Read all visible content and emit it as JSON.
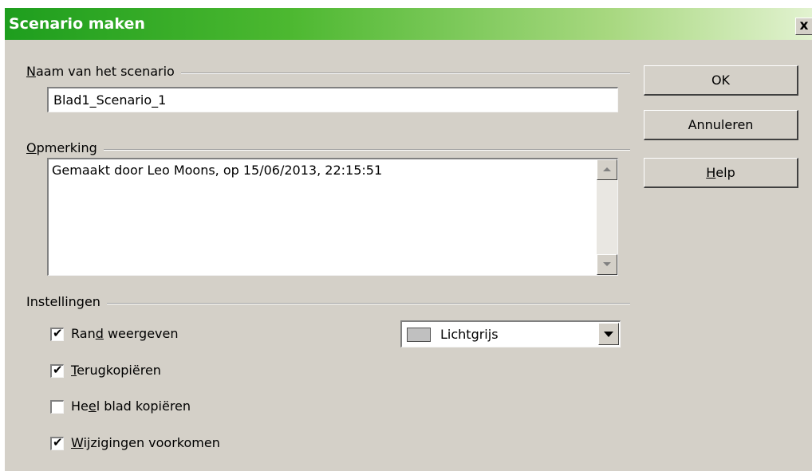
{
  "dialog": {
    "title": "Scenario maken",
    "close_label": "x"
  },
  "name_group": {
    "label_u": "N",
    "label_rest": "aam van het scenario",
    "value": "Blad1_Scenario_1"
  },
  "comment_group": {
    "label_u": "O",
    "label_rest": "pmerking",
    "value": "Gemaakt door Leo Moons, op 15/06/2013, 22:15:51"
  },
  "settings_group": {
    "label": "Instellingen",
    "checkboxes": [
      {
        "pre": "Ran",
        "u": "d",
        "post": " weergeven",
        "checked": true,
        "check_glyph": "✔"
      },
      {
        "pre": "",
        "u": "T",
        "post": "erugkopiëren",
        "checked": true,
        "check_glyph": "✔"
      },
      {
        "pre": "He",
        "u": "e",
        "post": "l blad kopiëren",
        "checked": false,
        "check_glyph": ""
      },
      {
        "pre": "",
        "u": "W",
        "post": "ijzigingen voorkomen",
        "checked": true,
        "check_glyph": "✔"
      }
    ],
    "color_select": {
      "value": "Lichtgrijs",
      "swatch_color": "#c0c0c0"
    }
  },
  "buttons": {
    "ok": "OK",
    "cancel": "Annuleren",
    "help_u": "H",
    "help_rest": "elp"
  },
  "colors": {
    "title_gradient_start": "#1e9e1e",
    "dialog_bg": "#d4d0c8"
  }
}
